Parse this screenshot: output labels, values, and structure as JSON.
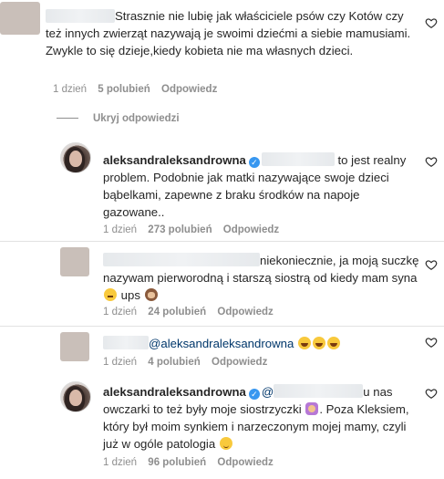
{
  "comments": [
    {
      "text": "Strasznie nie lubię jak właściciele psów czy Kotów czy też innych zwierząt nazywają je swoimi dziećmi a siebie mamusiami. Zwykle to się dzieje,kiedy kobieta nie ma własnych dzieci.",
      "time": "1 dzień",
      "likes": "5 polubień",
      "reply": "Odpowiedz"
    },
    {
      "username": "aleksandraleksandrowna",
      "text": " to jest realny problem. Podobnie jak matki nazywające swoje dzieci bąbelkami, zapewne z braku środków na napoje gazowane..",
      "time": "1 dzień",
      "likes": "273 polubień",
      "reply": "Odpowiedz"
    },
    {
      "text_before": "niekoniecznie, ja moją suczkę nazywam pierworodną i starszą siostrą od kiedy mam syna ",
      "text_mid": " ups ",
      "time": "1 dzień",
      "likes": "24 polubień",
      "reply": "Odpowiedz"
    },
    {
      "mention": "@aleksandraleksandrowna",
      "time": "1 dzień",
      "likes": "4 polubień",
      "reply": "Odpowiedz"
    },
    {
      "username": "aleksandraleksandrowna",
      "mention_at": "@",
      "line1_tail": "u nas",
      "text_a": "owczarki to też były moje siostrzyczki ",
      "text_b": ". Poza Kleksiem, który był moim synkiem i narzeczonym mojej mamy, czyli już w ogóle patologia ",
      "time": "1 dzień",
      "likes": "96 polubień",
      "reply": "Odpowiedz"
    }
  ],
  "hide_replies": "Ukryj odpowiedzi",
  "icons": {
    "verified": "verified-badge-icon",
    "like": "heart-outline-icon"
  },
  "colors": {
    "text": "#262626",
    "meta": "#8e8e8e",
    "mention": "#00376b",
    "verified": "#3897f0"
  }
}
